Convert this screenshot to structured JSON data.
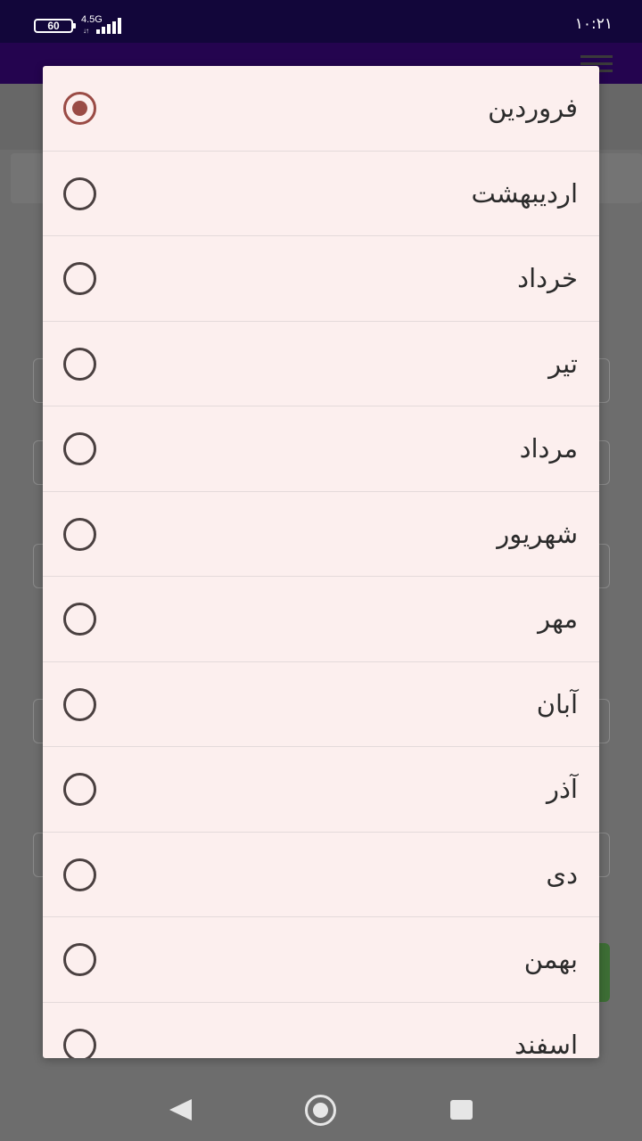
{
  "status_bar": {
    "battery_level": "60",
    "network_type": "4.5G",
    "network_activity": "↓↑",
    "time": "۱۰:۲۱"
  },
  "month_picker": {
    "selected_index": 0,
    "options": [
      {
        "label": "فروردین"
      },
      {
        "label": "اردیبهشت"
      },
      {
        "label": "خرداد"
      },
      {
        "label": "تیر"
      },
      {
        "label": "مرداد"
      },
      {
        "label": "شهریور"
      },
      {
        "label": "مهر"
      },
      {
        "label": "آبان"
      },
      {
        "label": "آذر"
      },
      {
        "label": "دی"
      },
      {
        "label": "بهمن"
      },
      {
        "label": "اسفند"
      }
    ]
  },
  "colors": {
    "status_bar": "#12063a",
    "app_bar": "#24044f",
    "dialog_background": "#fcefee",
    "radio_selected": "#9a4b45",
    "radio_unselected": "#4a4040"
  },
  "nav_bar": {
    "icons": [
      "back-icon",
      "home-icon",
      "recent-apps-icon"
    ]
  }
}
